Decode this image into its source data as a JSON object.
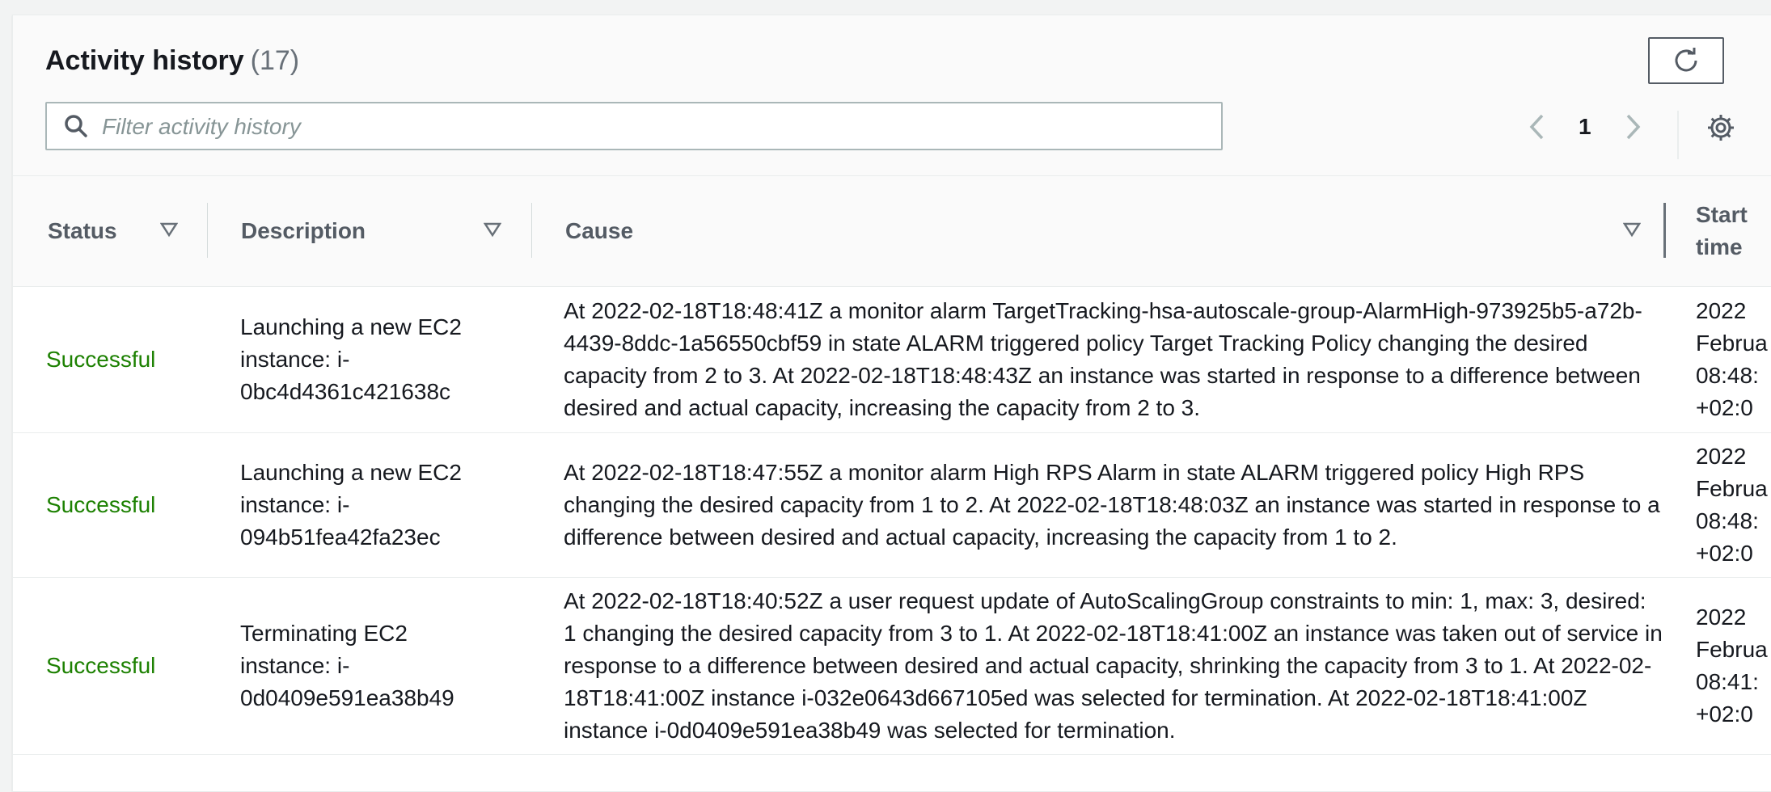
{
  "header": {
    "title": "Activity history",
    "count": "(17)"
  },
  "search": {
    "placeholder": "Filter activity history",
    "value": ""
  },
  "pagination": {
    "current_page": "1"
  },
  "table": {
    "columns": [
      "Status",
      "Description",
      "Cause",
      "Start time"
    ],
    "rows": [
      {
        "status": "Successful",
        "description": "Launching a new EC2 instance: i-0bc4d4361c421638c",
        "cause": "At 2022-02-18T18:48:41Z a monitor alarm TargetTracking-hsa-autoscale-group-AlarmHigh-973925b5-a72b-4439-8ddc-1a56550cbf59 in state ALARM triggered policy Target Tracking Policy changing the desired capacity from 2 to 3. At 2022-02-18T18:48:43Z an instance was started in response to a difference between desired and actual capacity, increasing the capacity from 2 to 3.",
        "start_time": "2022\nFebrua\n08:48:\n+02:0"
      },
      {
        "status": "Successful",
        "description": "Launching a new EC2 instance: i-094b51fea42fa23ec",
        "cause": "At 2022-02-18T18:47:55Z a monitor alarm High RPS Alarm in state ALARM triggered policy High RPS changing the desired capacity from 1 to 2. At 2022-02-18T18:48:03Z an instance was started in response to a difference between desired and actual capacity, increasing the capacity from 1 to 2.",
        "start_time": "2022\nFebrua\n08:48:\n+02:0"
      },
      {
        "status": "Successful",
        "description": "Terminating EC2 instance: i-0d0409e591ea38b49",
        "cause": "At 2022-02-18T18:40:52Z a user request update of AutoScalingGroup constraints to min: 1, max: 3, desired: 1 changing the desired capacity from 3 to 1. At 2022-02-18T18:41:00Z an instance was taken out of service in response to a difference between desired and actual capacity, shrinking the capacity from 3 to 1. At 2022-02-18T18:41:00Z instance i-032e0643d667105ed was selected for termination. At 2022-02-18T18:41:00Z instance i-0d0409e591ea38b49 was selected for termination.",
        "start_time": "2022\nFebrua\n08:41:\n+02:0"
      }
    ]
  },
  "colors": {
    "success": "#1d8102",
    "header_text": "#545b64",
    "border": "#aab7b8"
  },
  "icons": [
    "refresh-icon",
    "search-icon",
    "chevron-left-icon",
    "chevron-right-icon",
    "gear-icon",
    "sort-caret-icon"
  ]
}
